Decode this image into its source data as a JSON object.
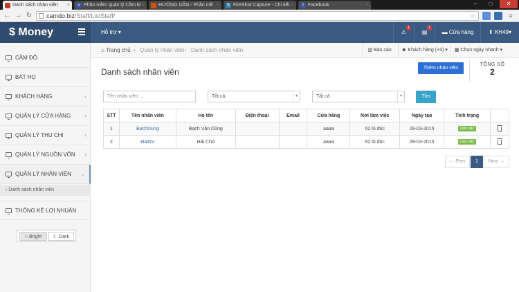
{
  "browser": {
    "tabs": [
      {
        "title": "Danh sách nhân viên",
        "active": true,
        "favicon": "page-icon",
        "fav_color": "#c0392b"
      },
      {
        "title": "Phần mềm quản lý Cầm Đ",
        "active": false,
        "favicon": "v-icon",
        "fav_color": "#3355aa"
      },
      {
        "title": "HƯỚNG DẪN - Phần mề",
        "active": false,
        "favicon": "page-icon",
        "fav_color": "#d35400"
      },
      {
        "title": "FireShot Capture - Chi tiết",
        "active": false,
        "favicon": "s-icon",
        "fav_color": "#2980b9"
      },
      {
        "title": "Facebook",
        "active": false,
        "favicon": "f-icon",
        "fav_color": "#3b5998"
      }
    ],
    "url_host": "camdo.biz",
    "url_path": "/Staff/ListStaff/"
  },
  "header": {
    "brand": "$ Money",
    "help_menu": "Hỗ trợ ▾",
    "badge_1": "1",
    "badge_2": "1",
    "store_label": "Cửa hàng",
    "user_label": "KH49▾"
  },
  "sidebar": {
    "items": [
      {
        "label": "Cầm đồ"
      },
      {
        "label": "Bát họ"
      },
      {
        "label": "Khách hàng",
        "chevron": "‹"
      },
      {
        "label": "Quản lý cửa hàng",
        "chevron": "‹"
      },
      {
        "label": "Quản lý thu chi",
        "chevron": "‹"
      },
      {
        "label": "Quản lý nguồn vốn",
        "chevron": "‹"
      },
      {
        "label": "Quản lý nhân viên",
        "chevron": "⌄"
      },
      {
        "label": "Thống kê lợi nhuận"
      }
    ],
    "sub_item": "› Danh sách nhân viên",
    "theme_bright": "Bright",
    "theme_dark": "Dark"
  },
  "breadcrumb": {
    "home": "Trang chủ",
    "level1": "Quản lý nhân viên",
    "level2": "Danh sách nhân viên",
    "sep": "›",
    "report": "Báo cáo",
    "customers": "Khách hàng (+3) ▾",
    "date_pick": "Chọn ngày nhanh ▾"
  },
  "page": {
    "title": "Danh sách nhân viên",
    "add_button": "Thêm nhân viên",
    "total_label": "TỔNG SỐ",
    "total_value": "2"
  },
  "filters": {
    "name_placeholder": "Tên nhân viên ...",
    "select1": "Tất cả",
    "select2": "Tất cả",
    "search_button": "Tìm"
  },
  "table": {
    "headers": [
      "STT",
      "Tên nhân viên",
      "Họ tên",
      "Điện thoại",
      "Email",
      "Cửa hàng",
      "Nơi làm việc",
      "Ngày tạo",
      "Tình trạng",
      ""
    ],
    "rows": [
      {
        "stt": "1",
        "username": "BachDung",
        "fullname": "Bạch Văn Dũng",
        "phone": "",
        "email": "",
        "store": "aaaa",
        "workplace": "62 lò đúc",
        "created": "28-03-2015",
        "status": "Làm việc"
      },
      {
        "stt": "2",
        "username": "HaiNV",
        "fullname": "Hải Chó",
        "phone": "",
        "email": "",
        "store": "aaaa",
        "workplace": "62 lò đúc",
        "created": "28-03-2015",
        "status": "Làm việc"
      }
    ]
  },
  "pagination": {
    "prev": "← Prev",
    "current": "1",
    "next": "Next →"
  },
  "colors": {
    "header_bg": "#3a5a82",
    "brand_bg": "#2f4c6f",
    "add_button": "#2d6fd4",
    "search_button": "#3aa3c8",
    "status_active": "#7cbd4e"
  }
}
